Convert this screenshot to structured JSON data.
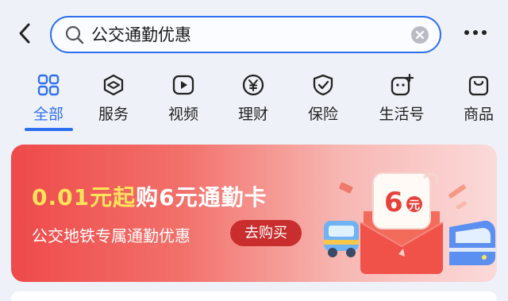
{
  "search": {
    "query": "公交通勤优惠"
  },
  "tabs": [
    {
      "label": "全部",
      "icon": "grid-icon",
      "active": true
    },
    {
      "label": "服务",
      "icon": "service-cube-icon"
    },
    {
      "label": "视频",
      "icon": "video-play-icon"
    },
    {
      "label": "理财",
      "icon": "yen-coin-icon"
    },
    {
      "label": "保险",
      "icon": "shield-check-icon"
    },
    {
      "label": "生活号",
      "icon": "life-account-icon"
    },
    {
      "label": "商品",
      "icon": "shopping-bag-icon"
    }
  ],
  "banner": {
    "title_highlight": "0.01元起",
    "title_rest": "购6元通勤卡",
    "subtitle": "公交地铁专属通勤优惠",
    "button_label": "去购买",
    "coupon_amount": "6",
    "coupon_unit": "元"
  },
  "colors": {
    "accent": "#2f6ff2",
    "banner_red": "#ee4a4a",
    "highlight_yellow": "#ffe35a",
    "button_red": "#c92d2d"
  }
}
